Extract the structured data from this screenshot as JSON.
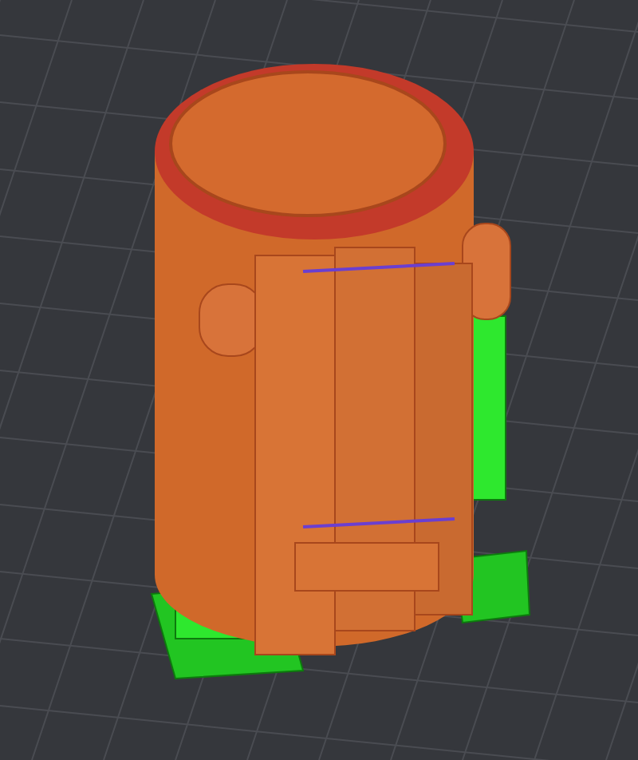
{
  "viewport": {
    "kind": "sliced-model"
  }
}
